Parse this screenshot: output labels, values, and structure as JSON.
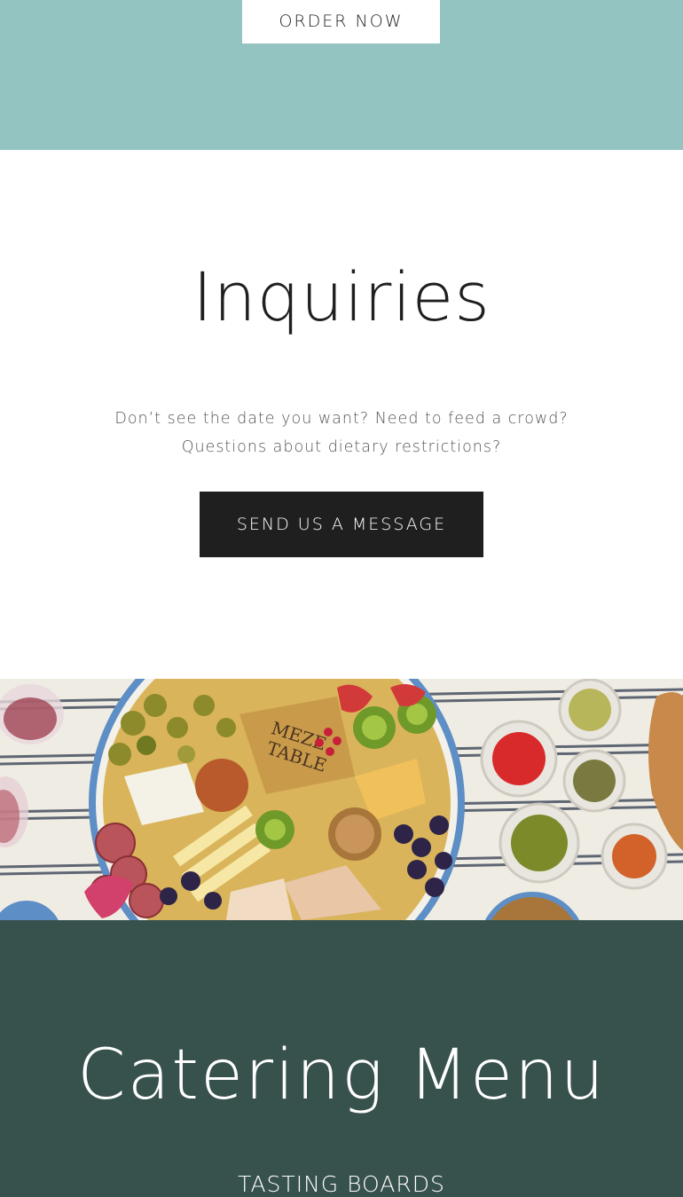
{
  "top_band": {
    "order_label": "ORDER NOW"
  },
  "inquiries": {
    "title": "Inquiries",
    "line1": "Don’t see the date you want? Need to feed a crowd?",
    "line2": "Questions about dietary restrictions?",
    "button_label": "SEND US A MESSAGE"
  },
  "photo": {
    "board_text_line1": "MEZE",
    "board_text_line2": "TABLE"
  },
  "catering": {
    "title": "Catering Menu",
    "subtitle": "TASTING BOARDS"
  },
  "colors": {
    "teal": "#93c4c1",
    "dark_green": "#37514d",
    "button_dark": "#1f1f1f"
  }
}
